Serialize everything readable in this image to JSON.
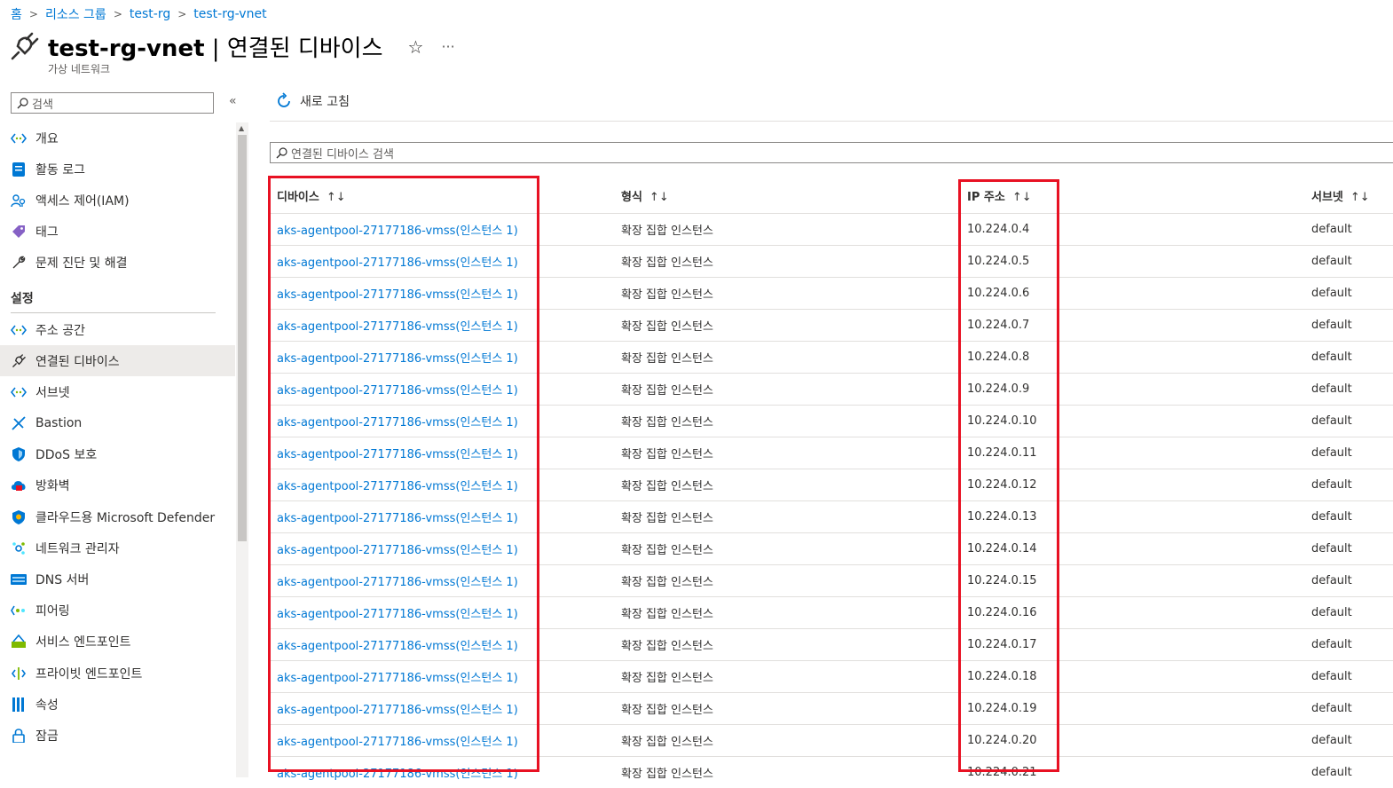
{
  "breadcrumb": [
    "홈",
    "리소스 그룹",
    "test-rg",
    "test-rg-vnet"
  ],
  "header": {
    "resource_name": "test-rg-vnet",
    "separator": " | ",
    "page_name": "연결된 디바이스",
    "subtitle": "가상 네트워크",
    "star": "☆",
    "more": "···"
  },
  "sidebar": {
    "search_placeholder": "검색",
    "collapse": "«",
    "items_top": [
      {
        "label": "개요",
        "icon": "overview-icon"
      },
      {
        "label": "활동 로그",
        "icon": "activity-log-icon"
      },
      {
        "label": "액세스 제어(IAM)",
        "icon": "iam-icon"
      },
      {
        "label": "태그",
        "icon": "tag-icon"
      },
      {
        "label": "문제 진단 및 해결",
        "icon": "wrench-icon"
      }
    ],
    "section_label": "설정",
    "items_settings": [
      {
        "label": "주소 공간",
        "icon": "address-space-icon"
      },
      {
        "label": "연결된 디바이스",
        "icon": "plug-icon",
        "active": true
      },
      {
        "label": "서브넷",
        "icon": "subnet-icon"
      },
      {
        "label": "Bastion",
        "icon": "bastion-icon"
      },
      {
        "label": "DDoS 보호",
        "icon": "shield-icon"
      },
      {
        "label": "방화벽",
        "icon": "firewall-icon"
      },
      {
        "label": "클라우드용 Microsoft Defender",
        "icon": "defender-icon"
      },
      {
        "label": "네트워크 관리자",
        "icon": "network-manager-icon"
      },
      {
        "label": "DNS 서버",
        "icon": "dns-icon"
      },
      {
        "label": "피어링",
        "icon": "peering-icon"
      },
      {
        "label": "서비스 엔드포인트",
        "icon": "service-endpoint-icon"
      },
      {
        "label": "프라이빗 엔드포인트",
        "icon": "private-endpoint-icon"
      },
      {
        "label": "속성",
        "icon": "properties-icon"
      },
      {
        "label": "잠금",
        "icon": "lock-icon"
      }
    ]
  },
  "toolbar": {
    "refresh_label": "새로 고침"
  },
  "table": {
    "search_placeholder": "연결된 디바이스 검색",
    "columns": [
      "디바이스",
      "형식",
      "IP 주소",
      "서브넷"
    ],
    "sort_glyph": "↑↓",
    "rows": [
      {
        "device": "aks-agentpool-27177186-vmss(인스턴스 1)",
        "type": "확장 집합 인스턴스",
        "ip": "10.224.0.4",
        "subnet": "default"
      },
      {
        "device": "aks-agentpool-27177186-vmss(인스턴스 1)",
        "type": "확장 집합 인스턴스",
        "ip": "10.224.0.5",
        "subnet": "default"
      },
      {
        "device": "aks-agentpool-27177186-vmss(인스턴스 1)",
        "type": "확장 집합 인스턴스",
        "ip": "10.224.0.6",
        "subnet": "default"
      },
      {
        "device": "aks-agentpool-27177186-vmss(인스턴스 1)",
        "type": "확장 집합 인스턴스",
        "ip": "10.224.0.7",
        "subnet": "default"
      },
      {
        "device": "aks-agentpool-27177186-vmss(인스턴스 1)",
        "type": "확장 집합 인스턴스",
        "ip": "10.224.0.8",
        "subnet": "default"
      },
      {
        "device": "aks-agentpool-27177186-vmss(인스턴스 1)",
        "type": "확장 집합 인스턴스",
        "ip": "10.224.0.9",
        "subnet": "default"
      },
      {
        "device": "aks-agentpool-27177186-vmss(인스턴스 1)",
        "type": "확장 집합 인스턴스",
        "ip": "10.224.0.10",
        "subnet": "default"
      },
      {
        "device": "aks-agentpool-27177186-vmss(인스턴스 1)",
        "type": "확장 집합 인스턴스",
        "ip": "10.224.0.11",
        "subnet": "default"
      },
      {
        "device": "aks-agentpool-27177186-vmss(인스턴스 1)",
        "type": "확장 집합 인스턴스",
        "ip": "10.224.0.12",
        "subnet": "default"
      },
      {
        "device": "aks-agentpool-27177186-vmss(인스턴스 1)",
        "type": "확장 집합 인스턴스",
        "ip": "10.224.0.13",
        "subnet": "default"
      },
      {
        "device": "aks-agentpool-27177186-vmss(인스턴스 1)",
        "type": "확장 집합 인스턴스",
        "ip": "10.224.0.14",
        "subnet": "default"
      },
      {
        "device": "aks-agentpool-27177186-vmss(인스턴스 1)",
        "type": "확장 집합 인스턴스",
        "ip": "10.224.0.15",
        "subnet": "default"
      },
      {
        "device": "aks-agentpool-27177186-vmss(인스턴스 1)",
        "type": "확장 집합 인스턴스",
        "ip": "10.224.0.16",
        "subnet": "default"
      },
      {
        "device": "aks-agentpool-27177186-vmss(인스턴스 1)",
        "type": "확장 집합 인스턴스",
        "ip": "10.224.0.17",
        "subnet": "default"
      },
      {
        "device": "aks-agentpool-27177186-vmss(인스턴스 1)",
        "type": "확장 집합 인스턴스",
        "ip": "10.224.0.18",
        "subnet": "default"
      },
      {
        "device": "aks-agentpool-27177186-vmss(인스턴스 1)",
        "type": "확장 집합 인스턴스",
        "ip": "10.224.0.19",
        "subnet": "default"
      },
      {
        "device": "aks-agentpool-27177186-vmss(인스턴스 1)",
        "type": "확장 집합 인스턴스",
        "ip": "10.224.0.20",
        "subnet": "default"
      },
      {
        "device": "aks-agentpool-27177186-vmss(인스턴스 1)",
        "type": "확장 집합 인스턴스",
        "ip": "10.224.0.21",
        "subnet": "default"
      }
    ]
  },
  "colors": {
    "link": "#0078d4",
    "highlight": "#e81123",
    "active_bg": "#edebe9"
  }
}
